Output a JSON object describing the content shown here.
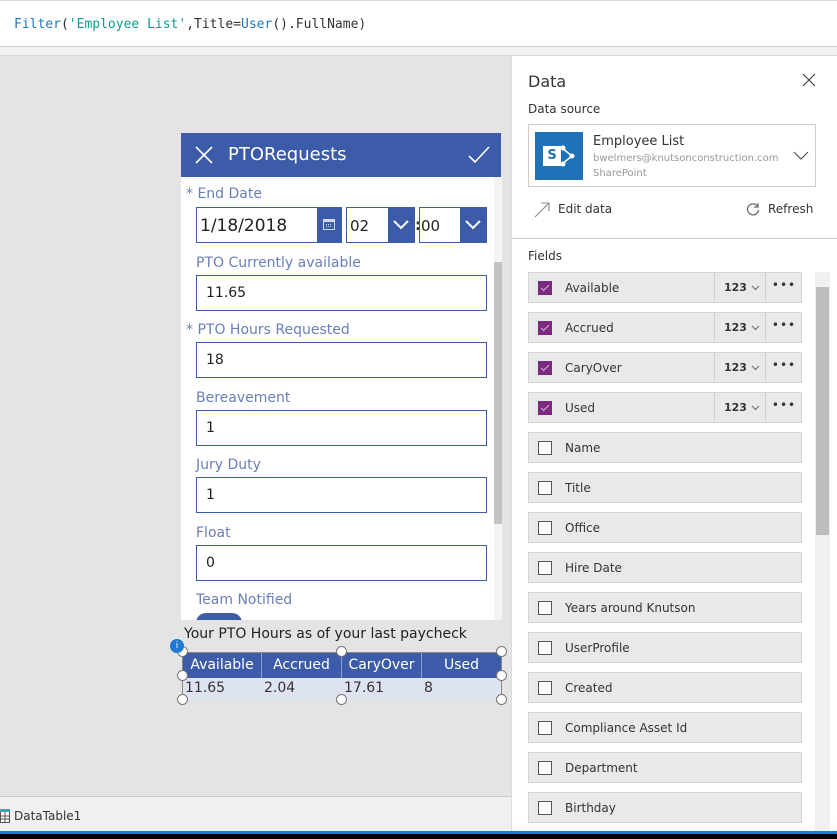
{
  "formula": {
    "fn1": "Filter",
    "open": "(",
    "str": "'Employee List'",
    "mid": ",Title=",
    "fn2": "User",
    "rest": "().FullName)"
  },
  "form": {
    "title": "PTORequests",
    "end_date": {
      "label": "End Date",
      "date": "1/18/2018",
      "hour": "02",
      "minute": "00",
      "sep": ":"
    },
    "fields": [
      {
        "label": "PTO Currently available",
        "value": "11.65",
        "required": false
      },
      {
        "label": "PTO Hours Requested",
        "value": "18",
        "required": true
      },
      {
        "label": "Bereavement",
        "value": "1",
        "required": false
      },
      {
        "label": "Jury Duty",
        "value": "1",
        "required": false
      },
      {
        "label": "Float",
        "value": "0",
        "required": false
      }
    ],
    "team_notified_label": "Team Notified",
    "required_mark": "*"
  },
  "table": {
    "label": "Your PTO Hours as of your last paycheck",
    "columns": [
      "Available",
      "Accrued",
      "CaryOver",
      "Used"
    ],
    "rows": [
      [
        "11.65",
        "2.04",
        "17.61",
        "8"
      ]
    ]
  },
  "panel": {
    "title": "Data",
    "data_source_label": "Data source",
    "source": {
      "name": "Employee List",
      "account": "bwelmers@knutsonconstruction.com",
      "type": "SharePoint"
    },
    "edit_data": "Edit data",
    "refresh": "Refresh",
    "fields_label": "Fields",
    "fields": [
      {
        "name": "Available",
        "checked": true,
        "type": "123"
      },
      {
        "name": "Accrued",
        "checked": true,
        "type": "123"
      },
      {
        "name": "CaryOver",
        "checked": true,
        "type": "123"
      },
      {
        "name": "Used",
        "checked": true,
        "type": "123"
      },
      {
        "name": "Name",
        "checked": false
      },
      {
        "name": "Title",
        "checked": false
      },
      {
        "name": "Office",
        "checked": false
      },
      {
        "name": "Hire Date",
        "checked": false
      },
      {
        "name": "Years around Knutson",
        "checked": false
      },
      {
        "name": "UserProfile",
        "checked": false
      },
      {
        "name": "Created",
        "checked": false
      },
      {
        "name": "Compliance Asset Id",
        "checked": false
      },
      {
        "name": "Department",
        "checked": false
      },
      {
        "name": "Birthday",
        "checked": false
      }
    ]
  },
  "status": {
    "selected_control": "DataTable1"
  },
  "colors": {
    "accent": "#3c5ba8",
    "checkbox": "#7b2a7e",
    "sharepoint": "#1f72b8"
  }
}
